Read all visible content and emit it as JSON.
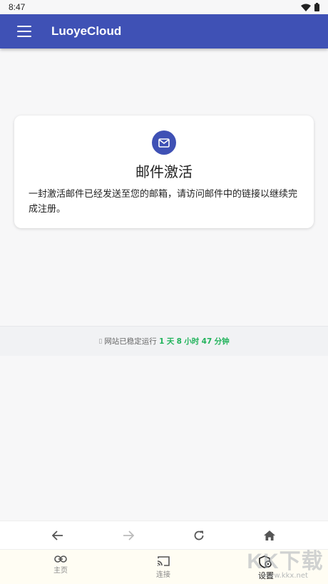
{
  "status": {
    "time": "8:47"
  },
  "app": {
    "title": "LuoyeCloud"
  },
  "card": {
    "icon": "mail-icon",
    "title": "邮件激活",
    "message": "一封激活邮件已经发送至您的邮箱，请访问邮件中的链接以继续完成注册。"
  },
  "footer": {
    "prefix": "网站已稳定运行",
    "days": "1",
    "day_unit": "天",
    "hours": "8",
    "hour_unit": "小时",
    "minutes": "47",
    "minute_unit": "分钟",
    "accent_color": "#21b35b"
  },
  "browser_nav": {
    "icons": [
      "back-arrow-icon",
      "forward-arrow-icon",
      "refresh-icon",
      "home-icon"
    ]
  },
  "bottom_tabs": [
    {
      "label": "主页",
      "icon": "link-icon"
    },
    {
      "label": "连接",
      "icon": "cast-icon"
    },
    {
      "label": "设置",
      "icon": "settings-icon"
    }
  ],
  "watermark": {
    "brand": "KK下载",
    "url": "www.kkx.net"
  },
  "colors": {
    "primary": "#3f51b5",
    "background": "#f7f7f8"
  }
}
